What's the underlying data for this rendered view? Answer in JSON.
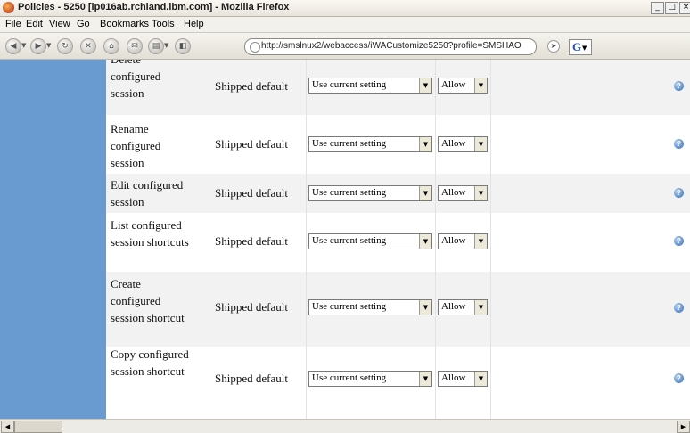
{
  "window": {
    "title": "Policies - 5250 [lp016ab.rchland.ibm.com] - Mozilla Firefox",
    "controls": {
      "minimize": "_",
      "maximize": "□",
      "close": "×"
    }
  },
  "menu": [
    "File",
    "Edit",
    "View",
    "Go",
    "Bookmarks",
    "Tools",
    "Help"
  ],
  "toolbar": {
    "url": "http://smslnux2/webaccess/iWACustomize5250?profile=SMSHAO",
    "search_engine_letter": "G"
  },
  "policies": [
    {
      "name": "Delete configured session",
      "default": "Shipped default",
      "setting": "Use current setting",
      "access": "Allow"
    },
    {
      "name": "Rename configured session",
      "default": "Shipped default",
      "setting": "Use current setting",
      "access": "Allow"
    },
    {
      "name": "Edit configured session",
      "default": "Shipped default",
      "setting": "Use current setting",
      "access": "Allow"
    },
    {
      "name": "List configured session shortcuts",
      "default": "Shipped default",
      "setting": "Use current setting",
      "access": "Allow"
    },
    {
      "name": "Create configured session shortcut",
      "default": "Shipped default",
      "setting": "Use current setting",
      "access": "Allow"
    },
    {
      "name": "Copy configured session shortcut",
      "default": "Shipped default",
      "setting": "Use current setting",
      "access": "Allow"
    }
  ],
  "colors": {
    "sidebar": "#6a9bd0",
    "row_shade": "#f2f2f2",
    "help_icon": "#4f84c7"
  }
}
